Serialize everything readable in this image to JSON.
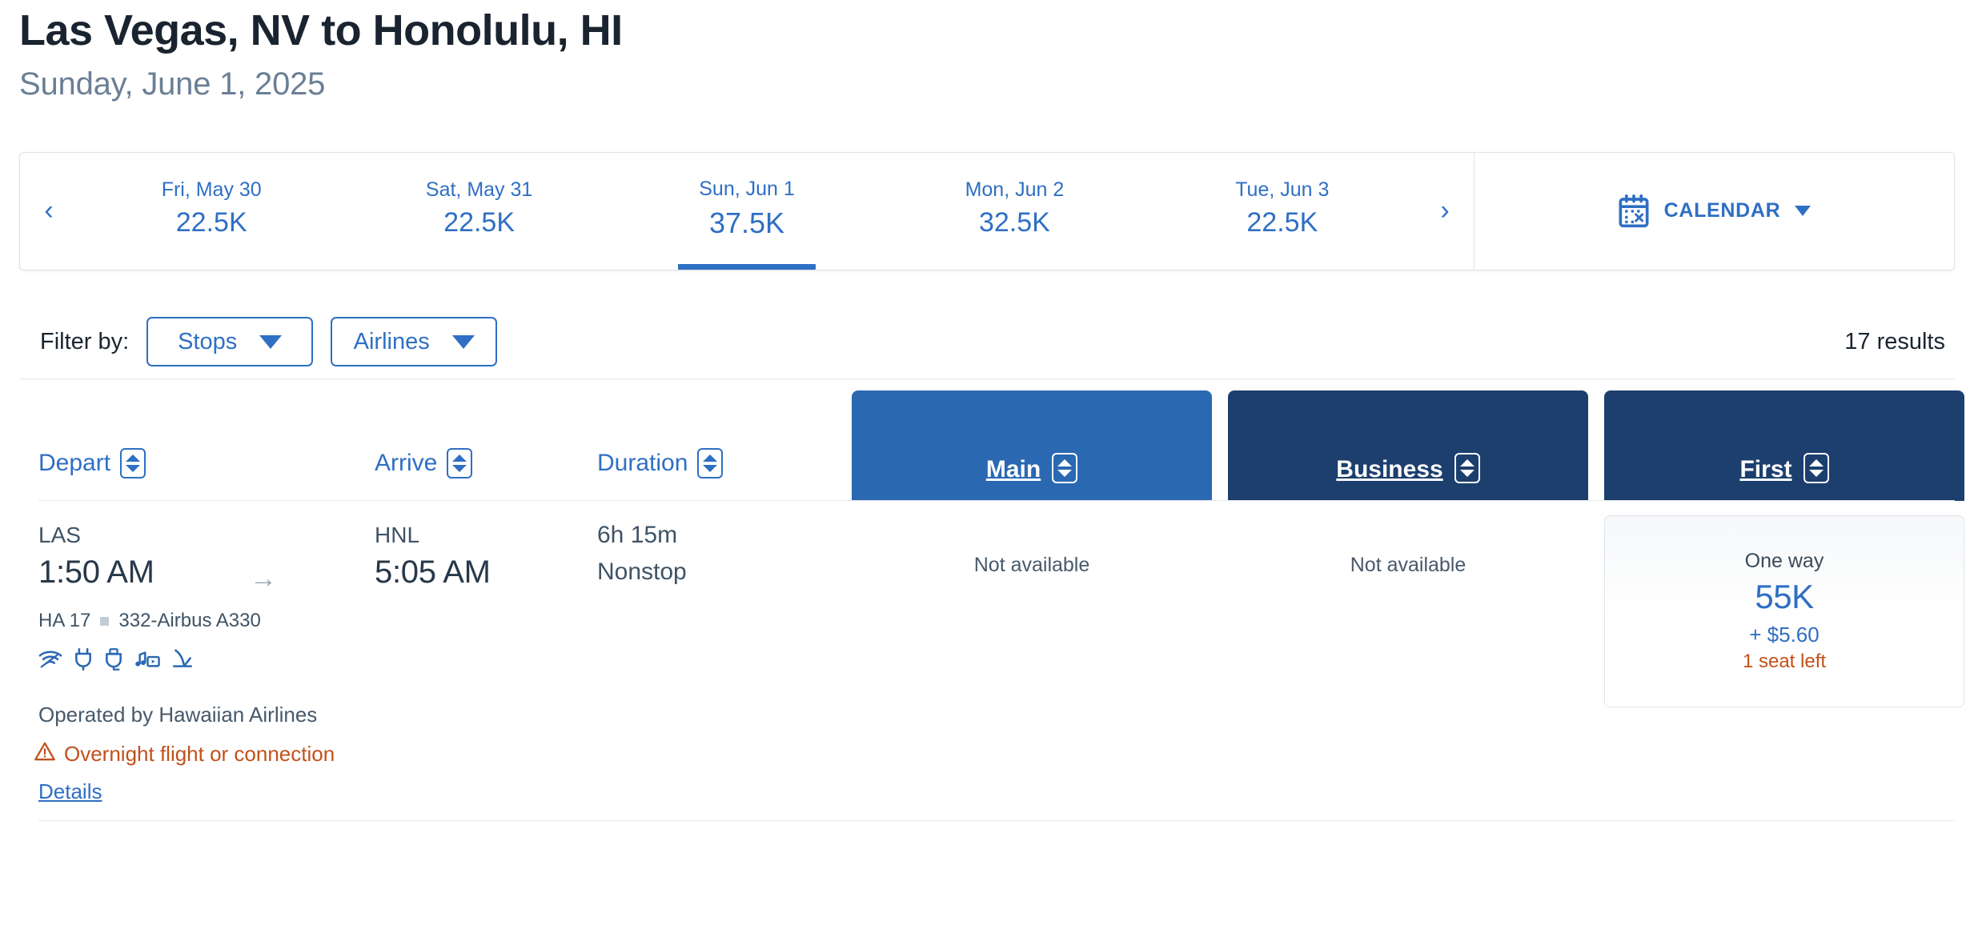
{
  "header": {
    "route_title": "Las Vegas, NV to Honolulu, HI",
    "date_subtitle": "Sunday, June 1, 2025"
  },
  "date_strip": {
    "prev_arrow": "‹",
    "next_arrow": "›",
    "calendar_label": "CALENDAR",
    "calendar_icon": "calendar-icon",
    "days": [
      {
        "label": "Fri, May 30",
        "price": "22.5K",
        "selected": false
      },
      {
        "label": "Sat, May 31",
        "price": "22.5K",
        "selected": false
      },
      {
        "label": "Sun, Jun 1",
        "price": "37.5K",
        "selected": true
      },
      {
        "label": "Mon, Jun 2",
        "price": "32.5K",
        "selected": false
      },
      {
        "label": "Tue, Jun 3",
        "price": "22.5K",
        "selected": false
      }
    ]
  },
  "filters": {
    "label": "Filter by:",
    "buttons": [
      {
        "label": "Stops"
      },
      {
        "label": "Airlines"
      }
    ],
    "results_count": "17 results"
  },
  "table": {
    "columns": [
      {
        "label": "Depart"
      },
      {
        "label": "Arrive"
      },
      {
        "label": "Duration"
      }
    ],
    "fare_columns": [
      {
        "label": "Main",
        "color": "#2a68b2"
      },
      {
        "label": "Business",
        "color": "#1c3f6e"
      },
      {
        "label": "First",
        "color": "#1c3f6e"
      }
    ]
  },
  "flights": [
    {
      "depart_code": "LAS",
      "depart_time": "1:50 AM",
      "arrive_code": "HNL",
      "arrive_time": "5:05 AM",
      "arrow": "→",
      "duration": "6h 15m",
      "stops": "Nonstop",
      "flight_number": "HA 17",
      "aircraft": "332-Airbus A330",
      "amenities": [
        "wifi-icon",
        "power-outlet-icon",
        "usb-port-icon",
        "entertainment-icon",
        "lie-flat-seat-icon"
      ],
      "operated_by": "Operated by Hawaiian Airlines",
      "warning": "Overnight flight or connection",
      "warning_icon": "warning-triangle-icon",
      "details_link": "Details",
      "fares": {
        "main": {
          "available": false,
          "text": "Not available"
        },
        "business": {
          "available": false,
          "text": "Not available"
        },
        "first": {
          "available": true,
          "trip_type": "One way",
          "points": "55K",
          "taxes": "+ $5.60",
          "seats_left": "1 seat left"
        }
      }
    }
  ],
  "colors": {
    "accent_blue": "#2f6fc4",
    "main_header": "#2a68b2",
    "premium_header": "#1c3f6e",
    "warning_orange": "#c2501b",
    "title_dark": "#1a2430",
    "muted": "#6b7f95"
  }
}
